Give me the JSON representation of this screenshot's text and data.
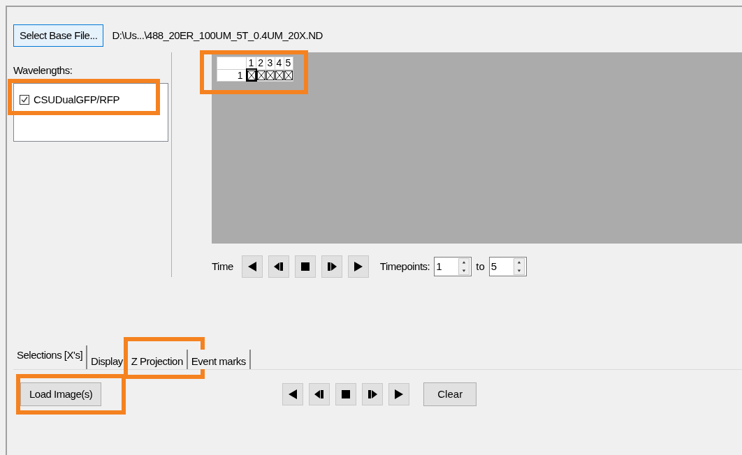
{
  "base_file": {
    "button": "Select Base File...",
    "path": "D:\\Us...\\488_20ER_100UM_5T_0.4UM_20X.ND"
  },
  "wavelengths": {
    "label": "Wavelengths:",
    "highlighted": true,
    "items": [
      {
        "label": "CSUDualGFP/RFP",
        "checked": true
      }
    ]
  },
  "grid": {
    "highlighted": true,
    "columns": [
      "1",
      "2",
      "3",
      "4",
      "5"
    ],
    "rows": [
      {
        "label": "1",
        "cells": [
          {
            "marked": true,
            "focused": true
          },
          {
            "marked": true,
            "focused": false
          },
          {
            "marked": true,
            "focused": false
          },
          {
            "marked": true,
            "focused": false
          },
          {
            "marked": true,
            "focused": false
          }
        ]
      }
    ]
  },
  "time": {
    "label": "Time",
    "controls": [
      {
        "kind": "first"
      },
      {
        "kind": "step-back"
      },
      {
        "kind": "stop"
      },
      {
        "kind": "step-forward"
      },
      {
        "kind": "last"
      }
    ],
    "timepoints_label": "Timepoints:",
    "from": "1",
    "to_label": "to",
    "to": "5"
  },
  "tabs": [
    {
      "label": "Selections [X's]",
      "selected": true,
      "highlighted": false
    },
    {
      "label": "Display",
      "selected": false,
      "highlighted": false
    },
    {
      "label": "Z Projection",
      "selected": false,
      "highlighted": true
    },
    {
      "label": "Event marks",
      "selected": false,
      "highlighted": false
    }
  ],
  "panel": {
    "load_button": {
      "label": "Load Image(s)",
      "highlighted": true
    },
    "controls": [
      {
        "kind": "first"
      },
      {
        "kind": "step-back"
      },
      {
        "kind": "stop"
      },
      {
        "kind": "step-forward"
      },
      {
        "kind": "last"
      }
    ],
    "clear_button": "Clear"
  }
}
